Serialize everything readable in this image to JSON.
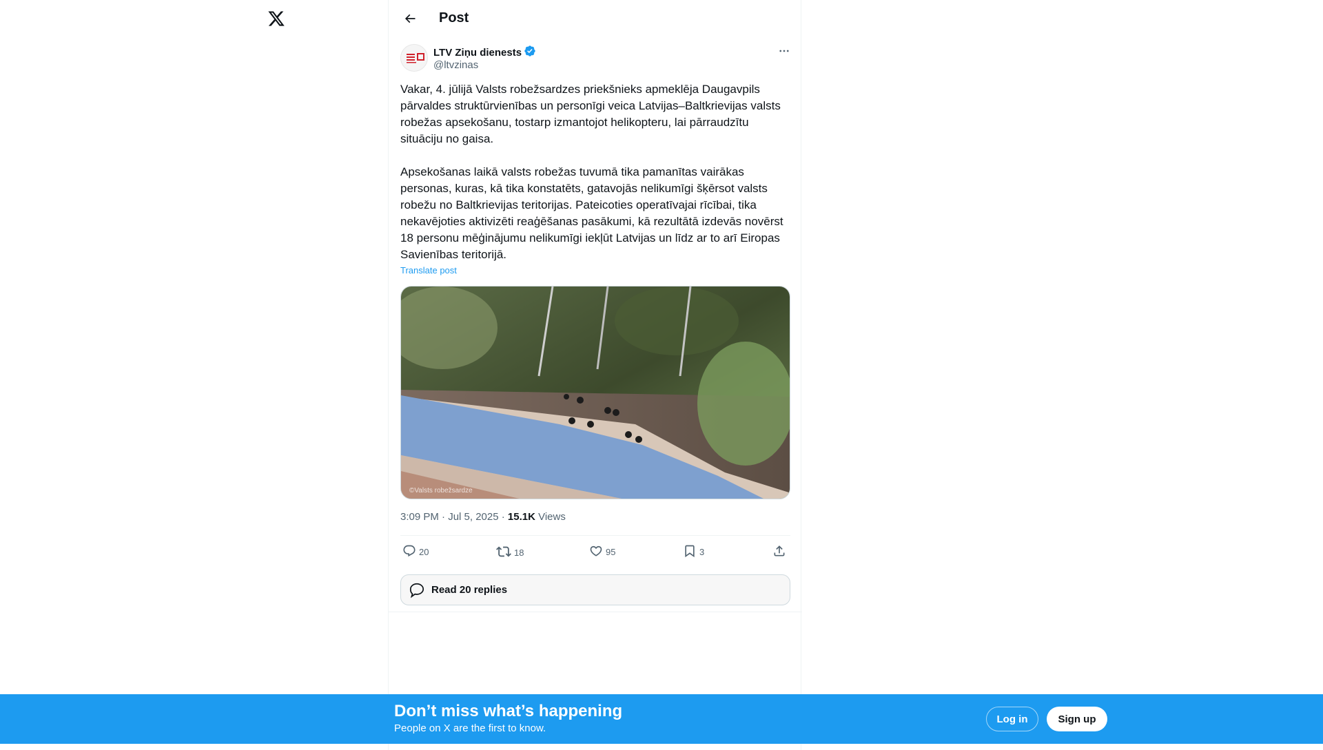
{
  "header": {
    "title": "Post",
    "back_icon": "arrow-left-icon"
  },
  "logo": {
    "icon": "x-logo-icon"
  },
  "author": {
    "name": "LTV Ziņu dienests",
    "handle": "@ltvzinas",
    "verified": true,
    "avatar_text": "LTV ZIŅU DIENESTS"
  },
  "post": {
    "text": "Vakar, 4. jūlijā Valsts robežsardzes priekšnieks apmeklēja Daugavpils pārvaldes struktūrvienības un personīgi veica Latvijas–Baltkrievijas valsts robežas apsekošanu, tostarp izmantojot helikopteru, lai pārraudzītu situāciju no gaisa.\n\nApsekošanas laikā valsts robežas tuvumā tika pamanītas vairākas personas, kuras, kā tika konstatēts, gatavojās nelikumīgi šķērsot valsts robežu no Baltkrievijas teritorijas. Pateicoties operatīvajai rīcībai, tika nekavējoties aktivizēti reaģēšanas pasākumi, kā rezultātā izdevās novērst 18 personu mēģinājumu nelikumīgi iekļūt Latvijas un līdz ar to arī Eiropas Savienības teritorijā.",
    "translate_label": "Translate post",
    "image_watermark": "©Valsts robežsardze",
    "time": "3:09 PM · Jul 5, 2025 · ",
    "views_count": "15.1K",
    "views_label": " Views"
  },
  "actions": {
    "replies": "20",
    "reposts": "18",
    "likes": "95",
    "bookmarks": "3"
  },
  "read_replies_label": "Read 20 replies",
  "banner": {
    "title": "Don’t miss what’s happening",
    "subtitle": "People on X are the first to know.",
    "login_label": "Log in",
    "signup_label": "Sign up"
  },
  "colors": {
    "accent": "#1d9bf0",
    "text": "#0f1419",
    "secondary": "#536471"
  }
}
